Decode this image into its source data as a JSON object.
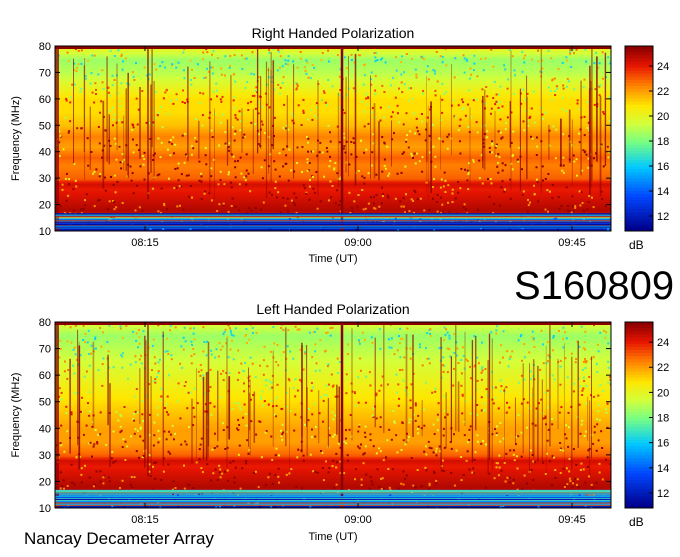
{
  "station_id": "S160809",
  "instrument": "Nancay Decameter Array",
  "chart_data": [
    {
      "type": "heatmap",
      "title": "Right Handed Polarization",
      "xlabel": "Time (UT)",
      "ylabel": "Frequency (MHz)",
      "x_ticks": [
        "08:15",
        "09:00",
        "09:45"
      ],
      "y_ticks": [
        10,
        20,
        30,
        40,
        50,
        60,
        70,
        80
      ],
      "ylim": [
        10,
        80
      ],
      "colorbar": {
        "label": "dB",
        "ticks": [
          12,
          14,
          16,
          18,
          20,
          22,
          24
        ],
        "range": [
          10.8,
          25.6
        ]
      },
      "intensity_profile_mhz_db": [
        [
          10,
          11.5
        ],
        [
          13,
          12.5
        ],
        [
          15,
          15.5
        ],
        [
          16,
          24.5
        ],
        [
          18,
          25
        ],
        [
          22,
          24.5
        ],
        [
          26,
          24
        ],
        [
          28,
          24.5
        ],
        [
          30,
          23
        ],
        [
          35,
          22.5
        ],
        [
          38,
          23
        ],
        [
          42,
          22
        ],
        [
          46,
          22.5
        ],
        [
          50,
          21.5
        ],
        [
          55,
          21
        ],
        [
          60,
          21
        ],
        [
          65,
          20
        ],
        [
          70,
          19
        ],
        [
          75,
          18.5
        ],
        [
          79,
          20
        ],
        [
          80,
          24
        ]
      ]
    },
    {
      "type": "heatmap",
      "title": "Left Handed Polarization",
      "xlabel": "Time (UT)",
      "ylabel": "Frequency (MHz)",
      "x_ticks": [
        "08:15",
        "09:00",
        "09:45"
      ],
      "y_ticks": [
        10,
        20,
        30,
        40,
        50,
        60,
        70,
        80
      ],
      "ylim": [
        10,
        80
      ],
      "colorbar": {
        "label": "dB",
        "ticks": [
          12,
          14,
          16,
          18,
          20,
          22,
          24
        ],
        "range": [
          10.8,
          25.6
        ]
      },
      "intensity_profile_mhz_db": [
        [
          10,
          11.5
        ],
        [
          13,
          12.5
        ],
        [
          15,
          15.5
        ],
        [
          16,
          24.5
        ],
        [
          18,
          25
        ],
        [
          22,
          24.5
        ],
        [
          26,
          24
        ],
        [
          28,
          24.5
        ],
        [
          30,
          23
        ],
        [
          35,
          22
        ],
        [
          40,
          22
        ],
        [
          45,
          21.5
        ],
        [
          50,
          21
        ],
        [
          55,
          20.5
        ],
        [
          60,
          20
        ],
        [
          65,
          19.5
        ],
        [
          70,
          19
        ],
        [
          75,
          18.5
        ],
        [
          79,
          19.5
        ],
        [
          80,
          24
        ]
      ]
    }
  ],
  "colors": {
    "low": "#00008b",
    "mid_low": "#00bfff",
    "mid": "#adff2f",
    "mid_high": "#ffd700",
    "high": "#ff4500",
    "max": "#8b0000"
  }
}
